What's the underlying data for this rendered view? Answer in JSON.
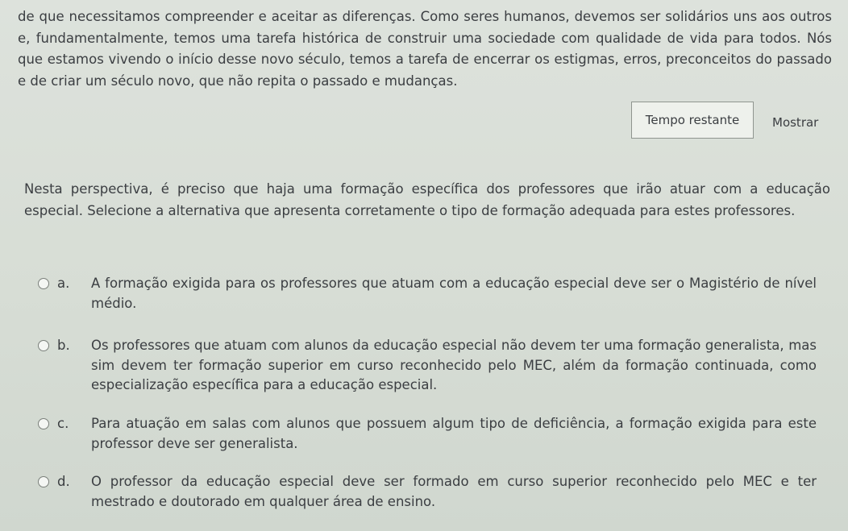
{
  "passage": {
    "text": "de que necessitamos compreender e aceitar as diferenças. Como seres humanos, devemos ser solidários uns aos outros e, fundamentalmente, temos uma tarefa histórica de construir uma sociedade com qualidade de vida para todos. Nós que estamos vivendo o início desse novo século, temos a tarefa de encerrar os estigmas, erros, preconceitos do passado e de criar um século novo, que não repita o passado e mudanças."
  },
  "timer": {
    "label": "Tempo restante",
    "show_label": "Mostrar"
  },
  "question": {
    "text": "Nesta perspectiva, é preciso que haja uma formação específica dos professores que irão atuar com a educação especial. Selecione a alternativa que apresenta corretamente o tipo de formação adequada para estes professores."
  },
  "options": [
    {
      "letter": "a.",
      "text": "A formação exigida para os professores que atuam com a educação especial deve ser o Magistério de nível médio."
    },
    {
      "letter": "b.",
      "text": "Os professores que atuam com alunos da educação especial não devem ter uma formação generalista, mas sim devem ter formação superior em curso reconhecido pelo MEC, além da formação continuada, como especialização específica para a educação especial."
    },
    {
      "letter": "c.",
      "text": "Para atuação em salas com alunos que possuem algum tipo de deficiência, a formação exigida para este professor deve ser generalista."
    },
    {
      "letter": "d.",
      "text": "O professor da educação especial deve ser formado em curso superior reconhecido pelo MEC e ter mestrado e doutorado em qualquer área de ensino."
    }
  ]
}
